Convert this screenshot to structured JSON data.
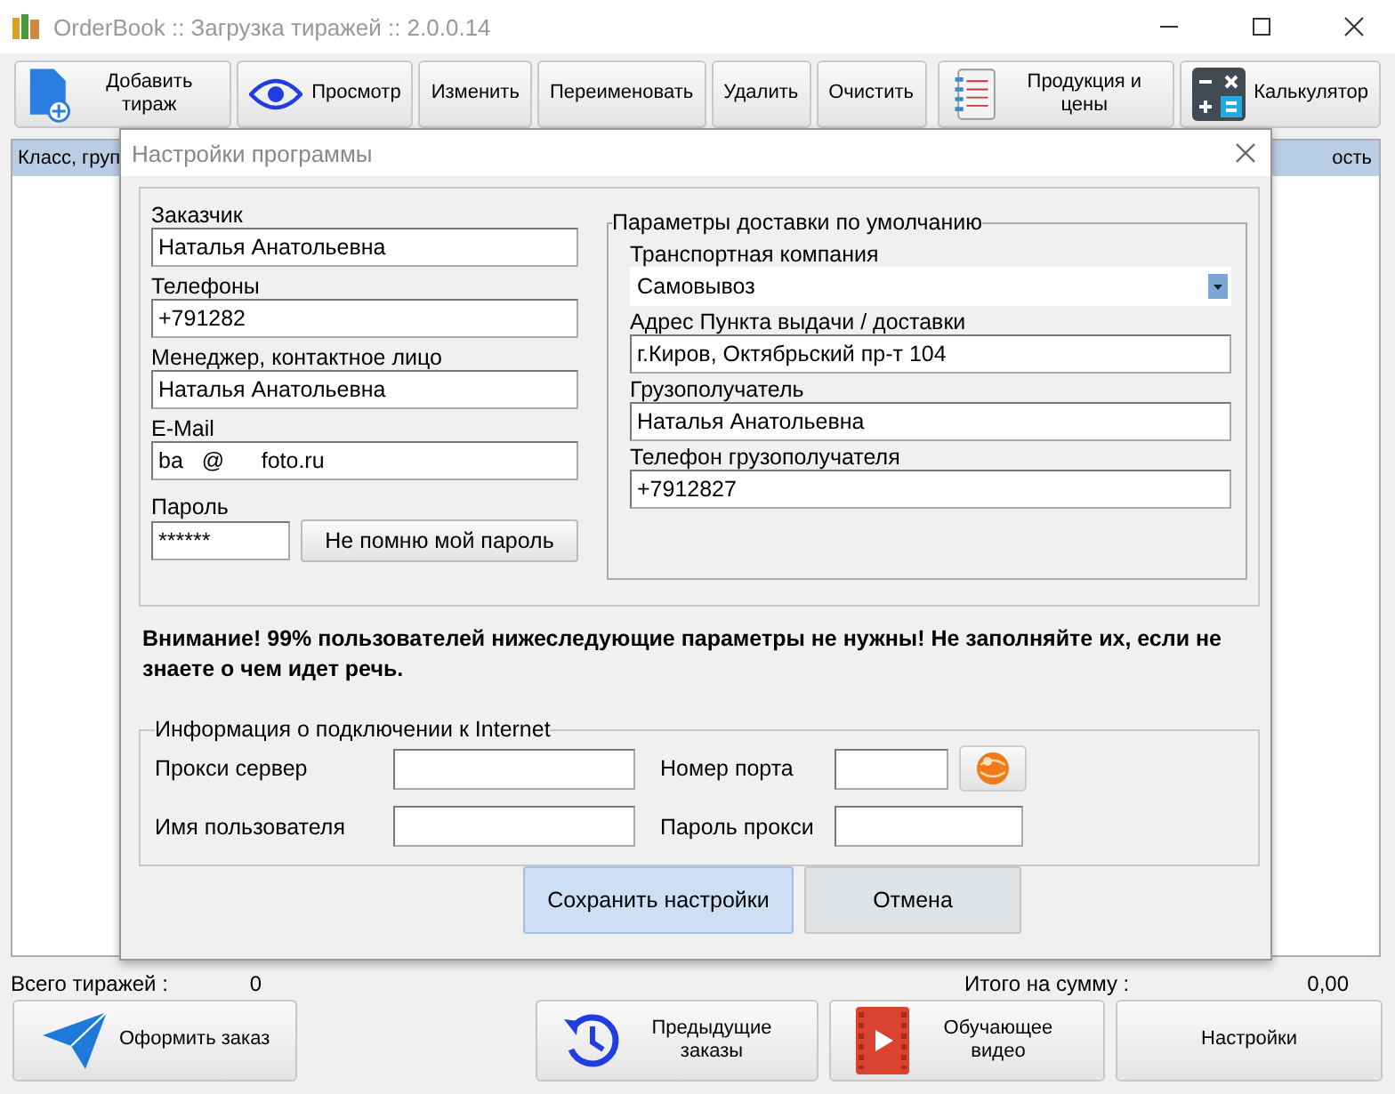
{
  "window": {
    "title": "OrderBook :: Загрузка тиражей :: 2.0.0.14"
  },
  "toolbar": [
    {
      "kind": "icon",
      "label": "Добавить тираж"
    },
    {
      "kind": "icon",
      "label": "Просмотр"
    },
    {
      "kind": "text",
      "label": "Изменить"
    },
    {
      "kind": "text",
      "label": "Переименовать"
    },
    {
      "kind": "text",
      "label": "Удалить"
    },
    {
      "kind": "text",
      "label": "Очистить"
    },
    {
      "kind": "spacer"
    },
    {
      "kind": "icon",
      "label": "Продукция и цены"
    },
    {
      "kind": "icon",
      "label": "Калькулятор"
    }
  ],
  "table": {
    "columns": [
      "Класс, груп",
      "ость"
    ]
  },
  "status": {
    "total_label": "Всего тиражей :",
    "total_value": "0",
    "sum_label": "Итого на сумму :",
    "sum_value": "0,00"
  },
  "bottom_buttons": [
    {
      "kind": "icon",
      "label": "Оформить заказ"
    },
    {
      "kind": "spacer"
    },
    {
      "kind": "icon",
      "label": "Предыдущие заказы"
    },
    {
      "kind": "icon",
      "label": "Обучающее видео"
    },
    {
      "kind": "text",
      "label": "Настройки"
    }
  ],
  "dialog": {
    "title": "Настройки программы",
    "left_fields": [
      {
        "label": "Заказчик",
        "value": "Наталья Анатольевна"
      },
      {
        "label": "Телефоны",
        "value": "+791282"
      },
      {
        "label": "Менеджер, контактное лицо",
        "value": "Наталья Анатольевна"
      },
      {
        "label": "E-Mail",
        "value": "ba   @      foto.ru"
      }
    ],
    "password": {
      "label": "Пароль",
      "value": "******",
      "button": "Не помню мой пароль"
    },
    "delivery": {
      "title": "Параметры доставки по умолчанию",
      "fields": [
        {
          "kind": "select",
          "label": "Транспортная компания",
          "value": "Самовывоз"
        },
        {
          "kind": "input",
          "label": "Адрес Пункта выдачи / доставки",
          "value": "г.Киров, Октябрьский пр-т 104"
        },
        {
          "kind": "input",
          "label": "Грузополучатель",
          "value": "Наталья Анатольевна"
        },
        {
          "kind": "input",
          "label": "Телефон грузополучателя",
          "value": "+7912827"
        }
      ]
    },
    "warning": "Внимание! 99% пользователей нижеследующие параметры не нужны! Не заполняйте их, если не знаете о чем идет речь.",
    "proxy": {
      "title": "Информация о подключении к Internet",
      "fields": [
        {
          "label": "Прокси сервер"
        },
        {
          "label": "Номер порта",
          "test_button": true
        },
        {
          "label": "Имя пользователя"
        },
        {
          "label": "Пароль прокси"
        }
      ]
    },
    "buttons": [
      {
        "label": "Сохранить настройки",
        "selected": true
      },
      {
        "label": "Отмена",
        "selected": false
      }
    ]
  }
}
